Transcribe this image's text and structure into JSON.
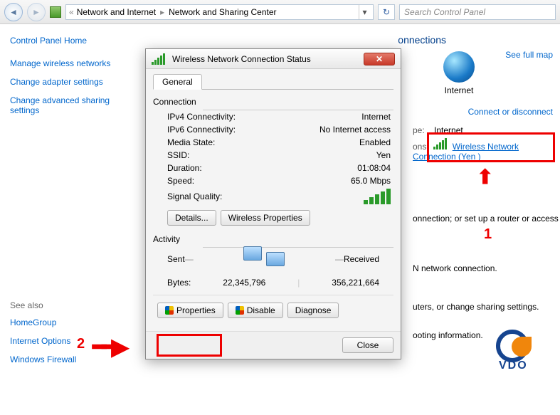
{
  "breadcrumb": {
    "level1": "Network and Internet",
    "level2": "Network and Sharing Center"
  },
  "search": {
    "placeholder": "Search Control Panel"
  },
  "sidebar": {
    "home": "Control Panel Home",
    "items": [
      "Manage wireless networks",
      "Change adapter settings",
      "Change advanced sharing settings"
    ],
    "see_also_label": "See also",
    "see_also": [
      "HomeGroup",
      "Internet Options",
      "Windows Firewall"
    ]
  },
  "content": {
    "heading_trail": "onnections",
    "see_full_map": "See full map",
    "internet_label": "Internet",
    "connect_disconnect": "Connect or disconnect",
    "access_label_trail": "pe:",
    "access_value": "Internet",
    "connections_label_trail": "ons:",
    "connection_link": "Wireless Network Connection (Yen )",
    "line1": "onnection; or set up a router or access",
    "line2": "N network connection.",
    "line3": "uters, or change sharing settings.",
    "line4": "ooting information."
  },
  "annotations": {
    "label1": "1",
    "label2": "2"
  },
  "dialog": {
    "title": "Wireless Network Connection Status",
    "tab": "General",
    "group_connection": "Connection",
    "rows": {
      "ipv4_k": "IPv4 Connectivity:",
      "ipv4_v": "Internet",
      "ipv6_k": "IPv6 Connectivity:",
      "ipv6_v": "No Internet access",
      "media_k": "Media State:",
      "media_v": "Enabled",
      "ssid_k": "SSID:",
      "ssid_v": "Yen",
      "dur_k": "Duration:",
      "dur_v": "01:08:04",
      "speed_k": "Speed:",
      "speed_v": "65.0 Mbps",
      "sig_k": "Signal Quality:"
    },
    "details_btn": "Details...",
    "wprops_btn": "Wireless Properties",
    "group_activity": "Activity",
    "sent_label": "Sent",
    "received_label": "Received",
    "bytes_label": "Bytes:",
    "bytes_sent": "22,345,796",
    "bytes_recv": "356,221,664",
    "properties_btn": "Properties",
    "disable_btn": "Disable",
    "diagnose_btn": "Diagnose",
    "close_btn": "Close"
  },
  "logo": {
    "text": "VDO"
  }
}
